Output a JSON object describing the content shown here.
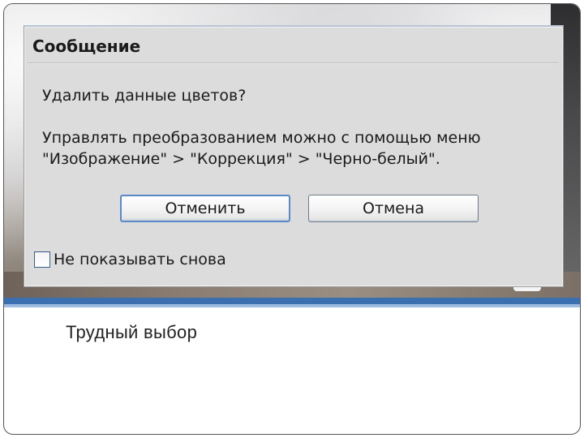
{
  "dialog": {
    "title": "Сообщение",
    "question": "Удалить данные цветов?",
    "hint_line1": "Управлять преобразованием можно с помощью меню",
    "hint_line2": "\"Изображение\" > \"Коррекция\" > \"Черно-белый\".",
    "confirm_label": "Отменить",
    "cancel_label": "Отмена",
    "dont_show_label": "Не показывать снова",
    "dont_show_checked": false
  },
  "slide": {
    "caption": "Трудный выбор"
  },
  "colors": {
    "accent_rule": "#3b6fb0",
    "dialog_bg": "#dcdcdc"
  }
}
